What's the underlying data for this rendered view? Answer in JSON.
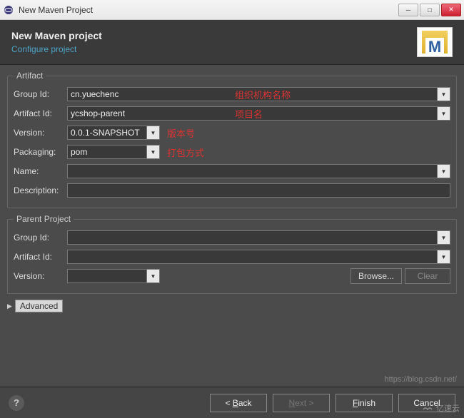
{
  "titlebar": {
    "title": "New Maven Project"
  },
  "header": {
    "title": "New Maven project",
    "subtitle": "Configure project"
  },
  "artifact": {
    "legend": "Artifact",
    "groupId": {
      "label": "Group Id:",
      "value": "cn.yuechenc",
      "note": "组织机构名称"
    },
    "artifactId": {
      "label": "Artifact Id:",
      "value": "ycshop-parent",
      "note": "项目名"
    },
    "version": {
      "label": "Version:",
      "value": "0.0.1-SNAPSHOT",
      "note": "版本号"
    },
    "packaging": {
      "label": "Packaging:",
      "value": "pom",
      "note": "打包方式"
    },
    "name": {
      "label": "Name:",
      "value": ""
    },
    "description": {
      "label": "Description:",
      "value": ""
    }
  },
  "parent": {
    "legend": "Parent Project",
    "groupId": {
      "label": "Group Id:",
      "value": ""
    },
    "artifactId": {
      "label": "Artifact Id:",
      "value": ""
    },
    "version": {
      "label": "Version:",
      "value": ""
    },
    "browse": "Browse...",
    "clear": "Clear"
  },
  "advanced": "Advanced",
  "footer": {
    "back": "< Back",
    "next": "Next >",
    "finish": "Finish",
    "cancel": "Cancel"
  },
  "watermark": "https://blog.csdn.net/",
  "watermark2": "亿速云"
}
